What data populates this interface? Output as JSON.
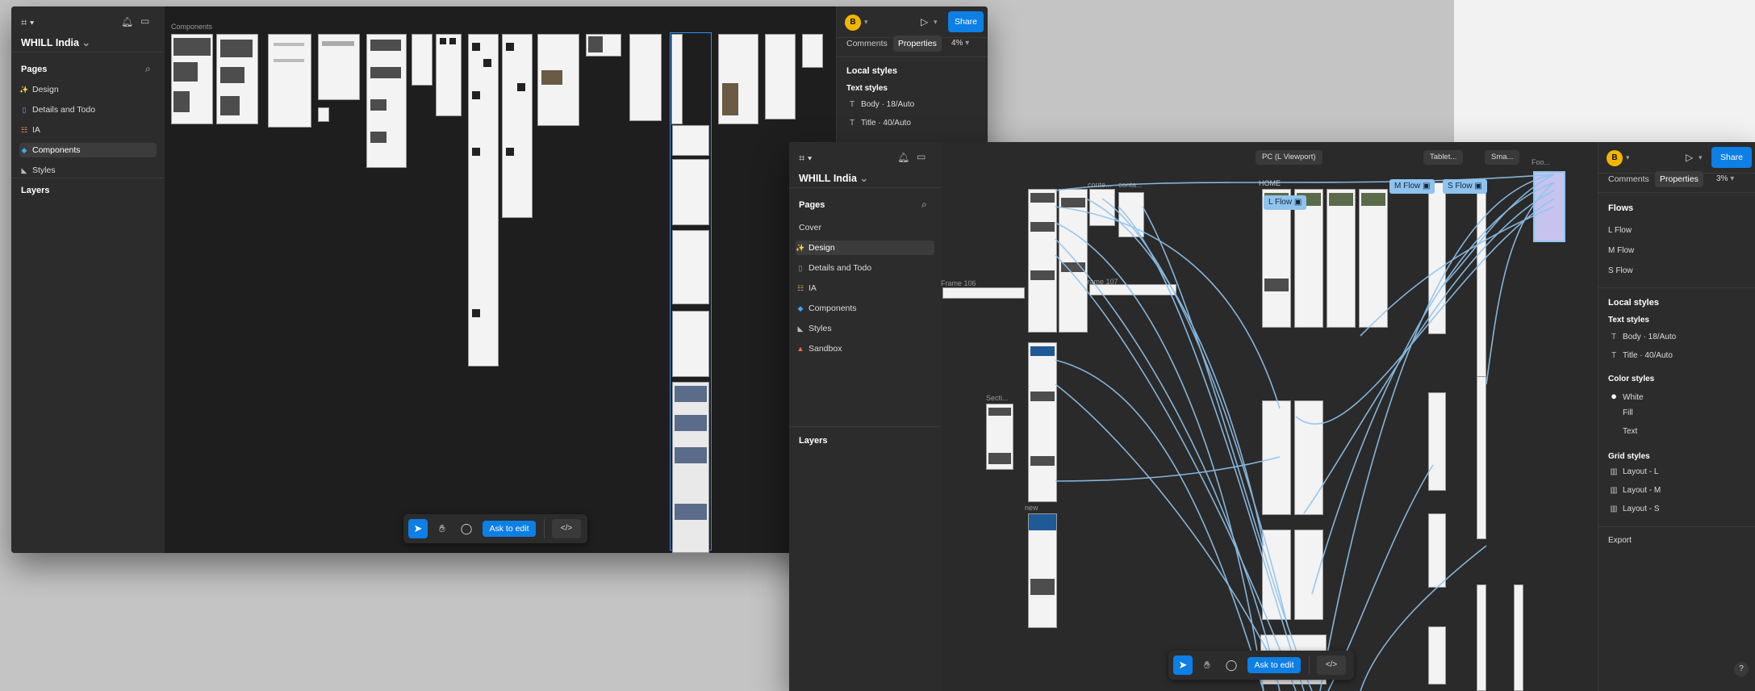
{
  "app": {
    "project_name": "WHILL India",
    "avatar_initial": "B"
  },
  "back_window": {
    "pages_label": "Pages",
    "layers_label": "Layers",
    "pages": [
      {
        "icon": "✨",
        "label": "Design"
      },
      {
        "icon": "▯",
        "label": "Details and Todo"
      },
      {
        "icon": "☷",
        "label": "IA"
      },
      {
        "icon": "◆",
        "label": "Components"
      },
      {
        "icon": "◣",
        "label": "Styles"
      }
    ],
    "selected_page": "Components",
    "canvas_label": "Components",
    "share_label": "Share",
    "tabs": [
      "Comments",
      "Properties"
    ],
    "zoom": "4%",
    "local_styles_label": "Local styles",
    "text_styles_label": "Text styles",
    "text_styles": [
      "Body · 18/Auto",
      "Title · 40/Auto"
    ],
    "ask_to_edit": "Ask to edit"
  },
  "front_window": {
    "pages_label": "Pages",
    "layers_label": "Layers",
    "pages": [
      {
        "icon": "",
        "label": "Cover"
      },
      {
        "icon": "✨",
        "label": "Design"
      },
      {
        "icon": "▯",
        "label": "Details and Todo"
      },
      {
        "icon": "☷",
        "label": "IA"
      },
      {
        "icon": "◆",
        "label": "Components"
      },
      {
        "icon": "◣",
        "label": "Styles"
      },
      {
        "icon": "▲",
        "label": "Sandbox"
      }
    ],
    "selected_page": "Design",
    "share_label": "Share",
    "tabs": [
      "Comments",
      "Properties"
    ],
    "zoom": "3%",
    "flows_label": "Flows",
    "flows": [
      "L Flow",
      "M Flow",
      "S Flow"
    ],
    "local_styles_label": "Local styles",
    "text_styles_label": "Text styles",
    "text_styles": [
      "Body · 18/Auto",
      "Title · 40/Auto"
    ],
    "color_styles_label": "Color styles",
    "color_styles": [
      "White",
      "Fill",
      "Text"
    ],
    "grid_styles_label": "Grid styles",
    "grid_styles": [
      "Layout - L",
      "Layout - M",
      "Layout - S"
    ],
    "export_label": "Export",
    "ask_to_edit": "Ask to edit",
    "canvas": {
      "viewport_pills": [
        "PC (L Viewport)",
        "Tablet...",
        "Sma..."
      ],
      "flow_labels": [
        "L Flow",
        "M Flow",
        "S Flow"
      ],
      "frame_labels": [
        "HOME",
        "conte...",
        "conta...",
        "Frame 106",
        "Frame 107",
        "Secti...",
        "new",
        "Foo..."
      ]
    }
  },
  "colors": {
    "accent": "#0d7fe5",
    "flow_line": "#8fc3ee",
    "panel": "#2c2c2c",
    "canvas": "#1e1e1e"
  }
}
